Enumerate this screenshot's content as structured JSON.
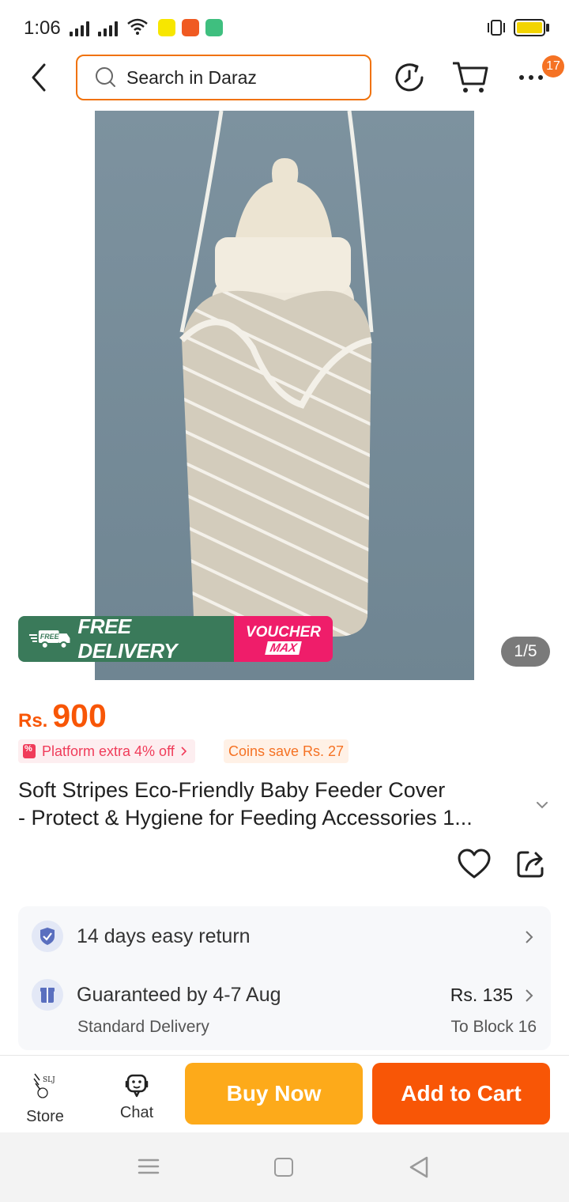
{
  "status_bar": {
    "time": "1:06",
    "battery_color": "#f2d400"
  },
  "header": {
    "search_placeholder": "Search in Daraz",
    "cart_badge": "17",
    "accent_color": "#f57224"
  },
  "gallery": {
    "image_description": "baby-feeder-cover-photo",
    "pager": "1/5",
    "free_delivery_label": "FREE DELIVERY",
    "free_tag": "FREE",
    "voucher_line1": "VOUCHER",
    "voucher_line2": "MAX"
  },
  "price": {
    "currency": "Rs.",
    "value": "900",
    "color": "#f85606"
  },
  "promos": {
    "platform": "Platform extra 4% off",
    "coins": "Coins save Rs. 27"
  },
  "product": {
    "title_line1": "Soft Stripes Eco-Friendly Baby Feeder Cover",
    "title_line2": "- Protect & Hygiene for Feeding Accessories 1..."
  },
  "service": {
    "return_text": "14 days easy return",
    "delivery_text": "Guaranteed by 4-7 Aug",
    "delivery_type": "Standard Delivery",
    "delivery_fee": "Rs. 135",
    "delivery_to": "To Block 16"
  },
  "bottom_bar": {
    "store_label": "Store",
    "store_logo_text": "SLJ",
    "chat_label": "Chat",
    "buy_now": "Buy Now",
    "add_to_cart": "Add to Cart",
    "buy_color": "#fdaa1a",
    "cart_color": "#f85606"
  }
}
